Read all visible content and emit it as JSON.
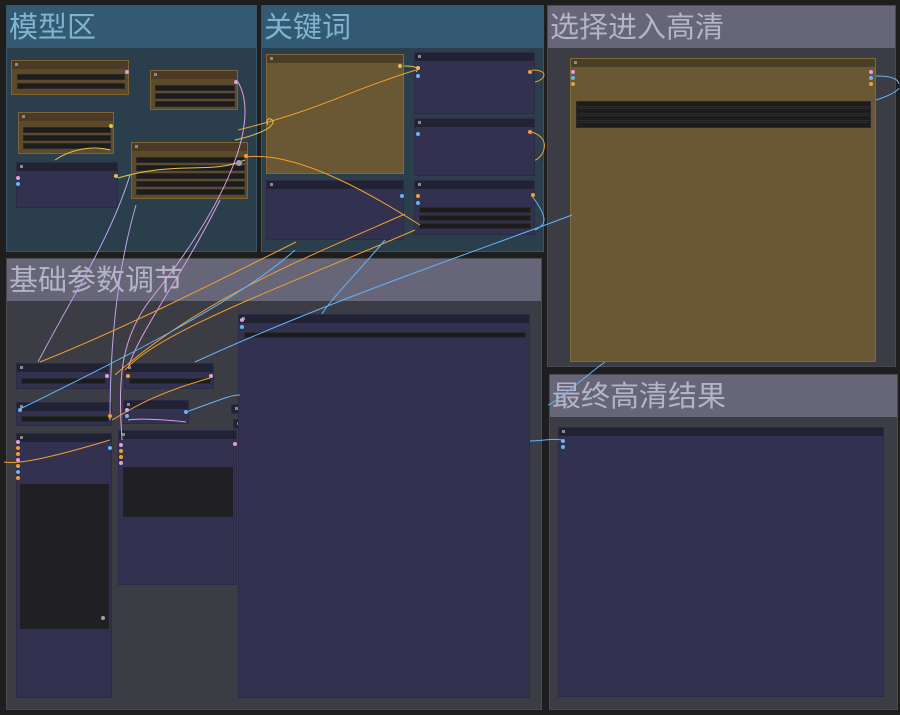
{
  "canvas": {
    "background": "#1e1e1e"
  },
  "groups": {
    "model": {
      "title": "模型区"
    },
    "keywords": {
      "title": "关键词"
    },
    "select_hires": {
      "title": "选择进入高清"
    },
    "base_params": {
      "title": "基础参数调节"
    },
    "final_hires": {
      "title": "最终高清结果"
    }
  },
  "colors": {
    "group_blue": "#2a3e4c",
    "group_gray": "#3c3c44",
    "node_brown": "#5c4a2b",
    "node_purple": "#333150",
    "wire_blue": "#64b5f6",
    "wire_orange": "#f0a030",
    "wire_yellow": "#e6c34a",
    "wire_pink": "#d9a0e0",
    "wire_lavender": "#b8a6e8"
  }
}
